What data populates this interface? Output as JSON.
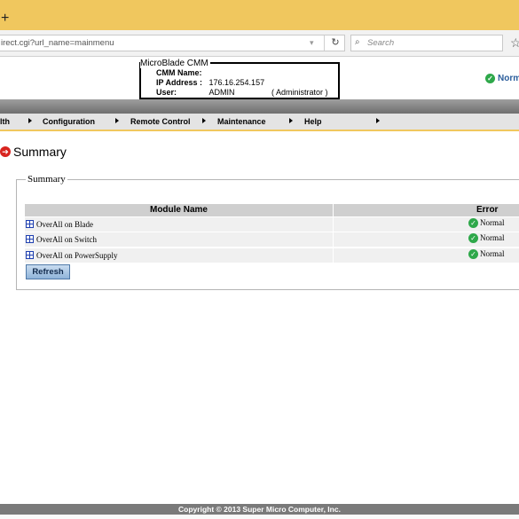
{
  "browser": {
    "new_tab_glyph": "+",
    "url": "irect.cgi?url_name=mainmenu",
    "search_placeholder": "Search"
  },
  "header": {
    "product": "MicroBlade CMM",
    "cmm_name_label": "CMM Name:",
    "cmm_name_value": "",
    "ip_label": "IP Address :",
    "ip_value": "176.16.254.157",
    "user_label": "User:",
    "user_value": "ADMIN",
    "user_role": "( Administrator )",
    "status": "Norm",
    "status_color": "#2ea84a"
  },
  "menu": {
    "items": [
      "lth",
      "Configuration",
      "Remote Control",
      "Maintenance",
      "Help"
    ]
  },
  "page": {
    "title": "Summary",
    "section_legend": "Summary",
    "columns": [
      "Module Name",
      "Error"
    ],
    "rows": [
      {
        "name": "OverAll on Blade",
        "status": "Normal"
      },
      {
        "name": "OverAll on Switch",
        "status": "Normal"
      },
      {
        "name": "OverAll on PowerSupply",
        "status": "Normal"
      }
    ],
    "refresh_label": "Refresh"
  },
  "footer": {
    "copyright": "Copyright © 2013 Super Micro Computer, Inc."
  },
  "colors": {
    "browser_titlebar": "#f0c75e",
    "accent_blue": "#1e3fb0",
    "ok_green": "#2ea84a",
    "title_arrow_red": "#d8241f"
  }
}
